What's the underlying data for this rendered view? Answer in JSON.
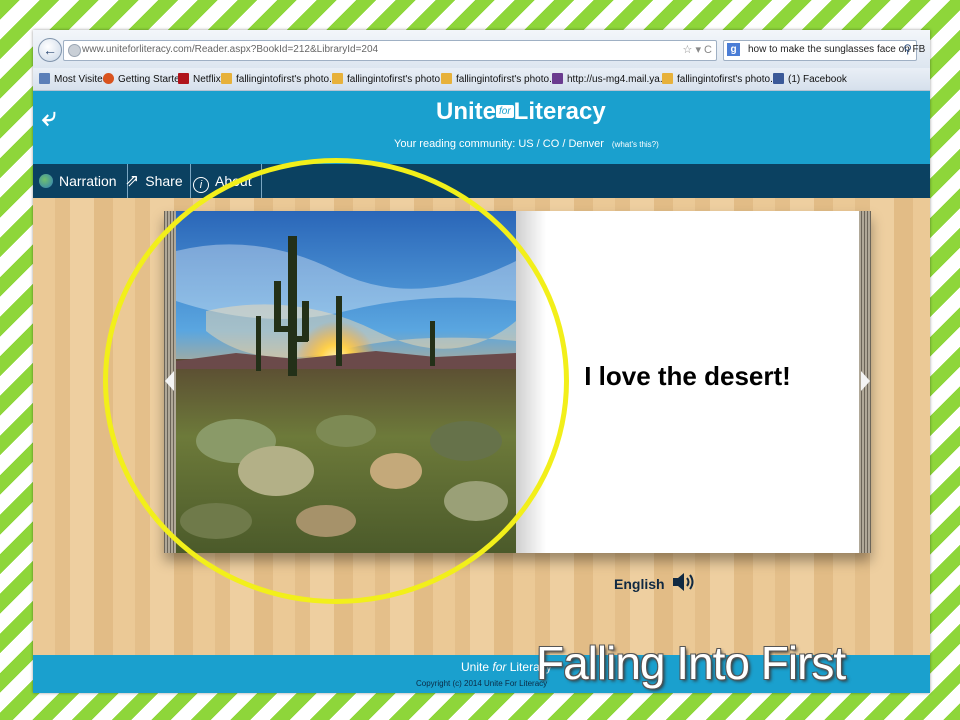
{
  "browser": {
    "url": "www.uniteforliteracy.com/Reader.aspx?BookId=212&LibraryId=204",
    "url_controls": "☆ ▾ C",
    "search_engine": "g",
    "search_query": "how to make the sunglasses face on FB",
    "bookmarks": [
      {
        "label": "Most Visited",
        "icon": "most-visited-icon",
        "color": "#5b7fb8"
      },
      {
        "label": "Getting Started",
        "icon": "firefox-icon",
        "color": "#d9531e"
      },
      {
        "label": "Netflix",
        "icon": "netflix-icon",
        "color": "#b0141b"
      },
      {
        "label": "fallingintofirst's photo...",
        "icon": "bookmark-page-icon",
        "color": "#e7b13a"
      },
      {
        "label": "fallingintofirst's photo...",
        "icon": "bookmark-page-icon",
        "color": "#e7b13a"
      },
      {
        "label": "fallingintofirst's photo...",
        "icon": "bookmark-page-icon",
        "color": "#e7b13a"
      },
      {
        "label": "http://us-mg4.mail.ya...",
        "icon": "mail-icon",
        "color": "#6a3b8f"
      },
      {
        "label": "fallingintofirst's photo...",
        "icon": "bookmark-page-icon",
        "color": "#e7b13a"
      },
      {
        "label": "(1) Facebook",
        "icon": "facebook-icon",
        "color": "#3b5998"
      }
    ]
  },
  "site": {
    "logo_left": "Unite",
    "logo_for": "for",
    "logo_right": "Literacy",
    "community": "Your reading community: US / CO / Denver",
    "whats_this": "(what's this?)",
    "toolbar": {
      "narration": "Narration",
      "share": "Share",
      "about": "About"
    },
    "page_text": "I love the desert!",
    "language": "English",
    "footer_logo_left": "Unite",
    "footer_logo_for": "for",
    "footer_logo_right": "Literacy",
    "copyright": "Copyright (c) 2014 Unite For Literacy"
  },
  "watermark": "Falling Into First",
  "colors": {
    "header_blue": "#1aa0ce",
    "toolbar_navy": "#0b4161",
    "highlight_circle": "#f2ef1a",
    "chevron_green": "#8ed63a"
  }
}
